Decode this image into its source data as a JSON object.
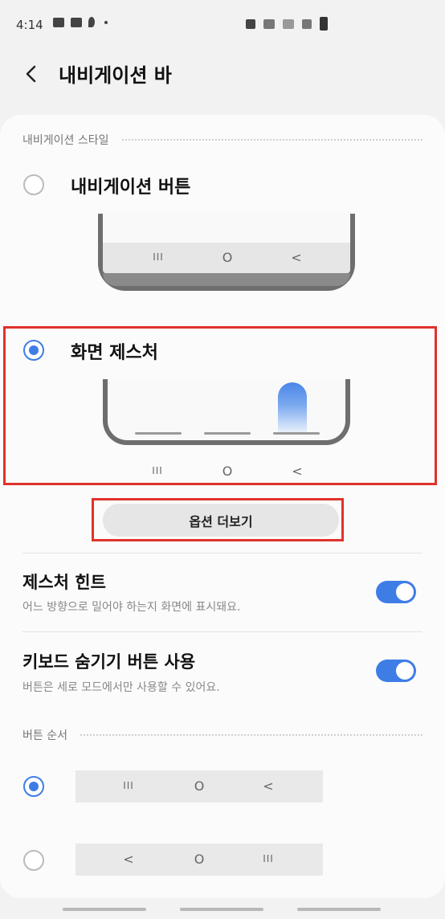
{
  "status_bar": {
    "time": "4:14"
  },
  "header": {
    "title": "내비게이션 바"
  },
  "navigation_style": {
    "section_title": "내비게이션 스타일",
    "options": [
      {
        "label": "내비게이션 버튼",
        "selected": false
      },
      {
        "label": "화면 제스처",
        "selected": true
      }
    ],
    "nav_glyphs": {
      "recent": "III",
      "home": "O",
      "back": "<"
    },
    "more_options_label": "옵션 더보기"
  },
  "settings": {
    "gesture_hint": {
      "title": "제스처 힌트",
      "description": "어느 방향으로 밀어야 하는지 화면에 표시돼요.",
      "enabled": true
    },
    "keyboard_hide_button": {
      "title": "키보드 숨기기 버튼 사용",
      "description": "버튼은 세로 모드에서만 사용할 수 있어요.",
      "enabled": true
    }
  },
  "button_order": {
    "section_title": "버튼 순서",
    "options": [
      {
        "glyphs": [
          "III",
          "O",
          "<"
        ],
        "selected": true
      },
      {
        "glyphs": [
          "<",
          "O",
          "III"
        ],
        "selected": false
      }
    ]
  },
  "colors": {
    "accent": "#3e7de6",
    "highlight": "#e0322b"
  }
}
